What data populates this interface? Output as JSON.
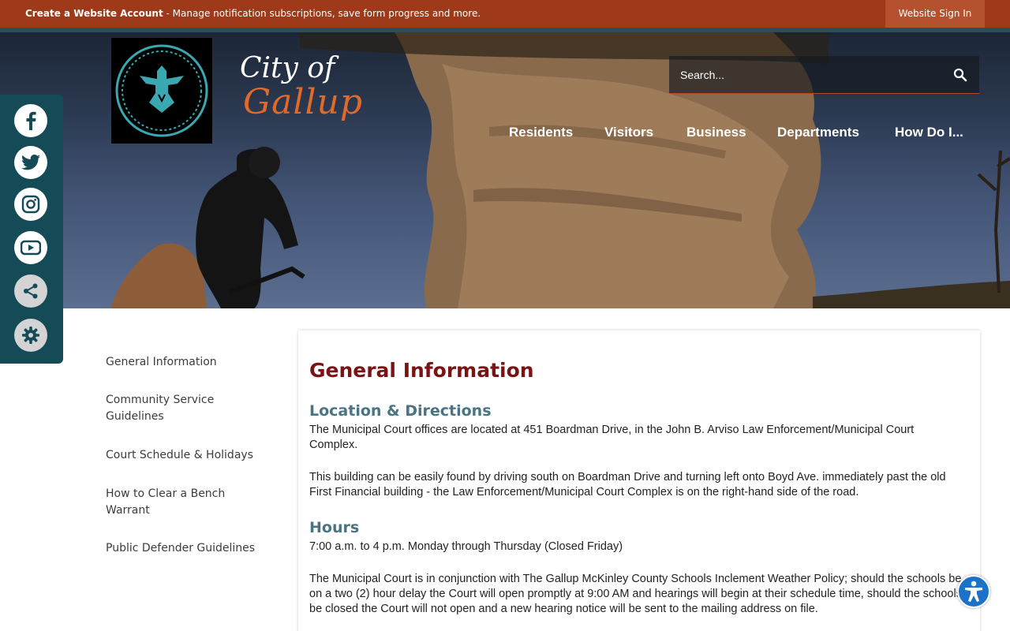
{
  "topbar": {
    "create_account_label": "Create a Website Account",
    "create_account_desc": " - Manage notification subscriptions, save form progress and more.",
    "signin_label": "Website Sign In"
  },
  "header": {
    "logo_city": "City of",
    "logo_name": "Gallup",
    "search_placeholder": "Search...",
    "nav": [
      "Residents",
      "Visitors",
      "Business",
      "Departments",
      "How Do I..."
    ]
  },
  "social": {
    "icons": [
      "facebook-icon",
      "twitter-icon",
      "instagram-icon",
      "youtube-icon",
      "share-icon",
      "settings-icon"
    ]
  },
  "sidebar": {
    "items": [
      {
        "label": "General Information"
      },
      {
        "label": "Community Service Guidelines"
      },
      {
        "label": "Court Schedule & Holidays"
      },
      {
        "label": "How to Clear a Bench Warrant"
      },
      {
        "label": "Public Defender Guidelines"
      }
    ]
  },
  "main": {
    "title": "General Information",
    "sections": [
      {
        "heading": "Location & Directions",
        "paragraphs": [
          "The Municipal Court offices are located at 451 Boardman Drive, in the John B. Arviso Law Enforcement/Municipal Court Complex.",
          "This building can be easily found by driving south on Boardman Drive and turning left onto Boyd Ave. immediately past the old First Financial building - the Law Enforcement/Municipal Court Complex is on the right-hand side of the road."
        ]
      },
      {
        "heading": "Hours",
        "paragraphs": [
          "7:00 a.m. to 4 p.m. Monday through Thursday (Closed Friday)",
          "The Municipal Court is in conjunction with The Gallup McKinley County Schools Inclement Weather Policy; should the schools be on a two (2) hour delay the Court will open promptly at 9:00 AM and hearings will begin at their schedule time, should the schools be closed the Court will not open and a new hearing notice will be sent to the mailing address on file."
        ]
      }
    ]
  },
  "colors": {
    "topbar": "#9e3a1a",
    "title": "#7a1414",
    "section_heading": "#4a7482",
    "social_bg": "#154a57",
    "logo_accent": "#e06a2a",
    "accessibility": "#1a73c8"
  }
}
